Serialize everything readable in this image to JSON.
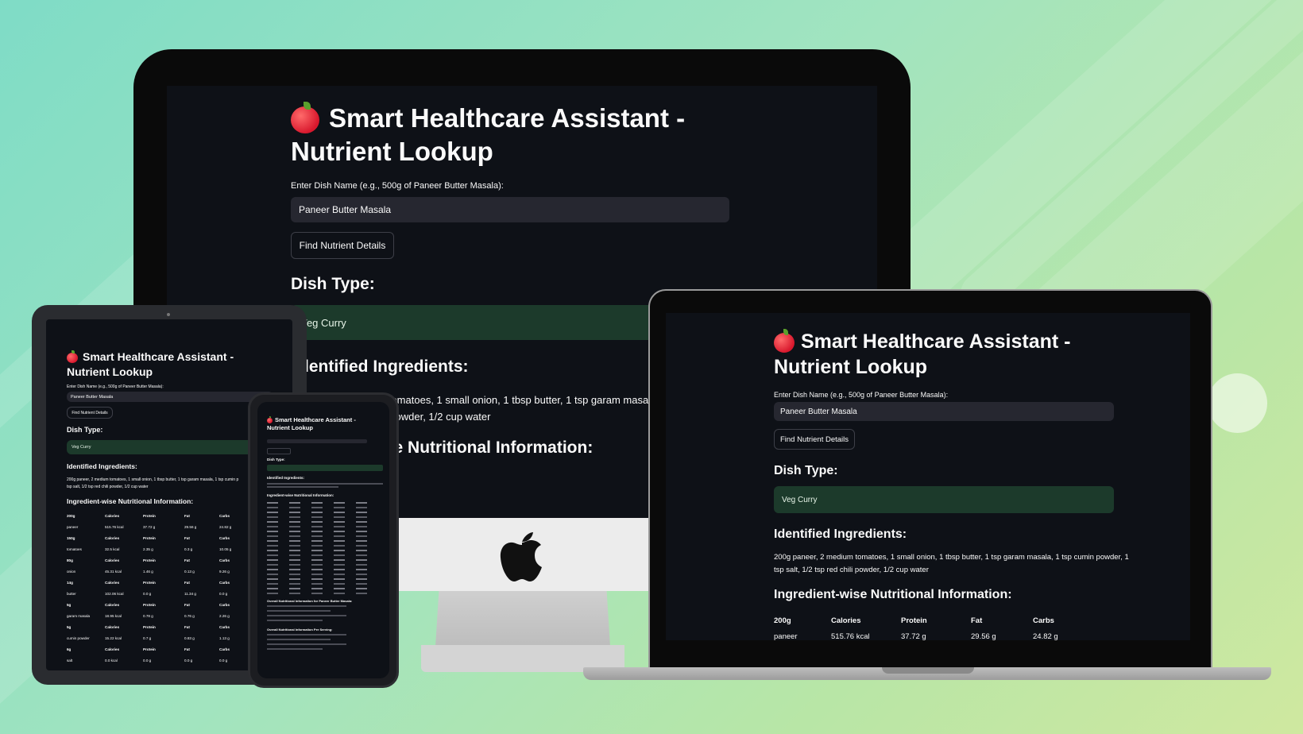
{
  "app": {
    "title": "Smart Healthcare Assistant - Nutrient Lookup",
    "title_line1": "Smart Healthcare Assistant -",
    "title_line2": "Nutrient Lookup",
    "input_label": "Enter Dish Name (e.g., 500g of Paneer Butter Masala):",
    "input_value": "Paneer Butter Masala",
    "button_label": "Find Nutrient Details",
    "dish_type_heading": "Dish Type:",
    "dish_type_value": "Veg Curry",
    "ingredients_heading": "Identified Ingredients:",
    "ingredients_text": "200g paneer, 2 medium tomatoes, 1 small onion, 1 tbsp butter, 1 tsp garam masala, 1 tsp cumin powder, 1 tsp salt, 1/2 tsp red chili powder, 1/2 cup water",
    "nutrition_heading": "Ingredient-wise Nutritional Information:",
    "overall_heading": "Overall Nutritional Information for Paneer Butter Masala:",
    "per_serving_heading": "Overall Nutritional Information Per Serving:"
  },
  "desktop_partial": {
    "ingredients_line1": "n tomatoes, 1 small onion, 1 tbsp butter, 1 tsp garam masal",
    "ingredients_line2": "ili powder, 1/2 cup water",
    "nutrition_heading_partial": "ise Nutritional Information:",
    "ingredients_heading_partial": "dentified Ingredients:"
  },
  "laptop": {
    "ingredients_line1": "200g paneer, 2 medium tomatoes, 1 small onion, 1 tbsp butter, 1 tsp garam masala, 1 tsp cumin powder, 1",
    "ingredients_line2": "tsp salt, 1/2 tsp red chili powder, 1/2 cup water"
  },
  "tablet": {
    "ingredients_line1": "200g paneer, 2 medium tomatoes, 1 small onion, 1 tbsp butter, 1 tsp garam masala, 1 tsp cumin p",
    "ingredients_line2": "tsp salt, 1/2 tsp red chili powder, 1/2 cup water"
  },
  "nutrition_table": {
    "headers": [
      "Calories",
      "Protein",
      "Fat",
      "Carbs"
    ],
    "rows": [
      {
        "qty": "200g",
        "name": "paneer",
        "calories": "515.76 kcal",
        "protein": "37.72 g",
        "fat": "29.56 g",
        "carbs": "24.82 g"
      },
      {
        "qty": "150g",
        "name": "tomatoes",
        "calories": "32.5 kcal",
        "protein": "2.35 g",
        "fat": "0.3 g",
        "carbs": "10.05 g"
      },
      {
        "qty": "80g",
        "name": "onion",
        "calories": "45.31 kcal",
        "protein": "1.46 g",
        "fat": "0.13 g",
        "carbs": "9.26 g"
      },
      {
        "qty": "14g",
        "name": "butter",
        "calories": "102.06 kcal",
        "protein": "0.0 g",
        "fat": "11.34 g",
        "carbs": "0.0 g"
      },
      {
        "qty": "5g",
        "name": "garam masala",
        "calories": "18.95 kcal",
        "protein": "0.78 g",
        "fat": "0.76 g",
        "carbs": "2.26 g"
      },
      {
        "qty": "5g",
        "name": "cumin powder",
        "calories": "15.22 kcal",
        "protein": "0.7 g",
        "fat": "0.83 g",
        "carbs": "1.13 g"
      },
      {
        "qty": "6g",
        "name": "salt",
        "calories": "0.0 kcal",
        "protein": "0.0 g",
        "fat": "0.0 g",
        "carbs": "0.0 g"
      }
    ]
  },
  "colors": {
    "app_bg": "#0e1117",
    "input_bg": "#262730",
    "dish_type_bar": "#1c3a2b",
    "device_frame": "#111111"
  },
  "icons": {
    "title_icon": "red-apple-icon",
    "monitor_logo": "apple-logo-icon"
  }
}
